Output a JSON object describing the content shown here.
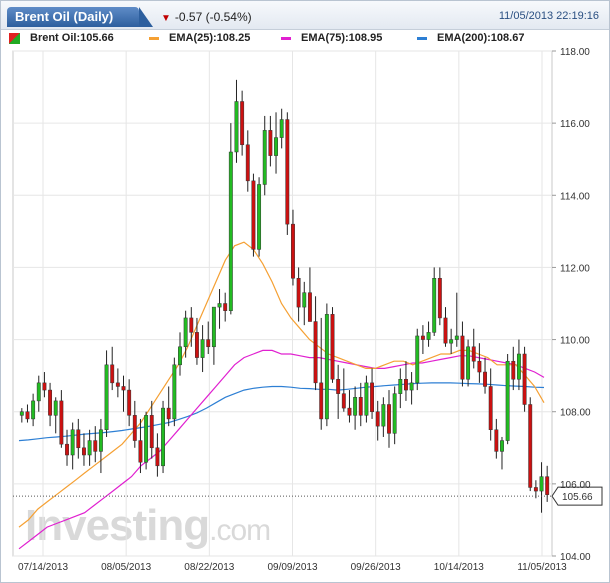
{
  "header": {
    "title": "Brent Oil (Daily)",
    "change": "-0.57 (-0.54%)",
    "datetime": "11/05/2013 22:19:16"
  },
  "legend": {
    "price": "Brent Oil:105.66",
    "ema25": "EMA(25):108.25",
    "ema75": "EMA(75):108.95",
    "ema200": "EMA(200):108.67"
  },
  "watermark": {
    "main": "Investing",
    "suffix": ".com"
  },
  "colors": {
    "up": "#22bb22",
    "down": "#cc1111",
    "ema25": "#f5a033",
    "ema75": "#e020d0",
    "ema200": "#2d7fd4",
    "grid": "#e6e6e6"
  },
  "chart_data": {
    "type": "candlestick",
    "ylim": [
      104,
      118
    ],
    "y_ticks": [
      "104.00",
      "106.00",
      "108.00",
      "110.00",
      "112.00",
      "114.00",
      "116.00",
      "118.00"
    ],
    "x_ticks": [
      "07/14/2013",
      "08/05/2013",
      "08/22/2013",
      "09/09/2013",
      "09/26/2013",
      "10/14/2013",
      "11/05/2013"
    ],
    "last_price": "105.66",
    "ohlc": [
      [
        107.9,
        108.1,
        107.7,
        108.0
      ],
      [
        108.0,
        108.2,
        107.7,
        107.8
      ],
      [
        107.8,
        108.5,
        107.6,
        108.3
      ],
      [
        108.3,
        109.0,
        108.0,
        108.8
      ],
      [
        108.8,
        109.1,
        108.4,
        108.6
      ],
      [
        108.6,
        108.8,
        107.6,
        107.9
      ],
      [
        107.9,
        108.4,
        107.4,
        108.3
      ],
      [
        108.3,
        108.6,
        107.0,
        107.1
      ],
      [
        107.1,
        107.5,
        106.5,
        106.8
      ],
      [
        106.8,
        107.7,
        106.4,
        107.5
      ],
      [
        107.5,
        107.8,
        106.7,
        107.0
      ],
      [
        107.0,
        107.4,
        106.5,
        106.8
      ],
      [
        106.8,
        107.5,
        106.5,
        107.2
      ],
      [
        107.2,
        107.6,
        106.6,
        106.9
      ],
      [
        106.9,
        107.8,
        106.3,
        107.5
      ],
      [
        107.5,
        109.7,
        107.3,
        109.3
      ],
      [
        109.3,
        109.8,
        108.6,
        108.8
      ],
      [
        108.8,
        109.2,
        108.4,
        108.7
      ],
      [
        108.7,
        109.0,
        108.0,
        108.6
      ],
      [
        108.6,
        108.9,
        107.6,
        107.9
      ],
      [
        107.9,
        108.3,
        107.0,
        107.2
      ],
      [
        107.2,
        107.8,
        106.3,
        106.6
      ],
      [
        106.6,
        108.0,
        106.4,
        107.9
      ],
      [
        107.9,
        108.3,
        106.7,
        107.0
      ],
      [
        107.0,
        107.4,
        106.2,
        106.5
      ],
      [
        106.5,
        108.3,
        106.3,
        108.1
      ],
      [
        108.1,
        108.7,
        107.6,
        107.8
      ],
      [
        107.8,
        109.5,
        107.6,
        109.3
      ],
      [
        109.3,
        110.2,
        109.0,
        109.8
      ],
      [
        109.8,
        110.8,
        109.5,
        110.6
      ],
      [
        110.6,
        110.9,
        109.8,
        110.2
      ],
      [
        110.2,
        110.6,
        109.3,
        109.5
      ],
      [
        109.5,
        110.4,
        109.1,
        110.0
      ],
      [
        110.0,
        110.5,
        109.6,
        109.8
      ],
      [
        109.8,
        110.6,
        109.3,
        110.9
      ],
      [
        110.9,
        111.4,
        110.3,
        111.0
      ],
      [
        111.0,
        111.3,
        110.5,
        110.8
      ],
      [
        110.8,
        116.0,
        110.7,
        115.2
      ],
      [
        115.2,
        117.2,
        114.9,
        116.6
      ],
      [
        116.6,
        116.9,
        115.1,
        115.4
      ],
      [
        115.4,
        115.8,
        114.1,
        114.4
      ],
      [
        114.4,
        114.6,
        112.3,
        112.5
      ],
      [
        112.5,
        114.5,
        112.3,
        114.3
      ],
      [
        114.3,
        116.2,
        114.0,
        115.8
      ],
      [
        115.8,
        116.2,
        114.8,
        115.1
      ],
      [
        115.1,
        116.3,
        114.6,
        115.6
      ],
      [
        115.6,
        116.4,
        115.3,
        116.1
      ],
      [
        116.1,
        116.3,
        112.9,
        113.2
      ],
      [
        113.2,
        113.6,
        111.5,
        111.7
      ],
      [
        111.7,
        112.0,
        110.5,
        110.9
      ],
      [
        110.9,
        111.6,
        110.4,
        111.3
      ],
      [
        111.3,
        112.0,
        110.6,
        110.5
      ],
      [
        110.5,
        111.2,
        108.6,
        108.8
      ],
      [
        108.8,
        110.6,
        107.5,
        107.8
      ],
      [
        107.8,
        111.0,
        107.6,
        110.7
      ],
      [
        110.7,
        110.9,
        108.8,
        108.9
      ],
      [
        108.9,
        109.3,
        107.8,
        108.5
      ],
      [
        108.5,
        109.2,
        108.0,
        108.1
      ],
      [
        108.1,
        108.6,
        107.7,
        107.9
      ],
      [
        107.9,
        108.7,
        107.5,
        108.4
      ],
      [
        108.4,
        108.8,
        107.6,
        107.9
      ],
      [
        107.9,
        109.0,
        107.7,
        108.8
      ],
      [
        108.8,
        109.2,
        107.8,
        108.0
      ],
      [
        108.0,
        108.3,
        107.2,
        107.6
      ],
      [
        107.6,
        108.4,
        107.3,
        108.2
      ],
      [
        108.2,
        108.6,
        107.0,
        107.4
      ],
      [
        107.4,
        108.7,
        107.1,
        108.5
      ],
      [
        108.5,
        109.2,
        108.1,
        108.9
      ],
      [
        108.9,
        109.4,
        108.3,
        108.6
      ],
      [
        108.6,
        109.1,
        108.2,
        108.8
      ],
      [
        108.8,
        110.3,
        108.6,
        110.1
      ],
      [
        110.1,
        110.4,
        109.6,
        110.0
      ],
      [
        110.0,
        110.5,
        109.8,
        110.2
      ],
      [
        110.2,
        112.0,
        110.1,
        111.7
      ],
      [
        111.7,
        112.0,
        110.4,
        110.6
      ],
      [
        110.6,
        110.9,
        109.8,
        109.9
      ],
      [
        109.9,
        110.3,
        109.6,
        110.0
      ],
      [
        110.0,
        111.3,
        109.8,
        110.1
      ],
      [
        110.1,
        110.5,
        108.7,
        108.9
      ],
      [
        108.9,
        110.0,
        108.7,
        109.8
      ],
      [
        109.8,
        110.3,
        109.2,
        109.4
      ],
      [
        109.4,
        109.9,
        108.8,
        109.1
      ],
      [
        109.1,
        109.5,
        108.5,
        108.7
      ],
      [
        108.7,
        109.2,
        107.2,
        107.5
      ],
      [
        107.5,
        107.8,
        106.7,
        106.9
      ],
      [
        106.9,
        107.3,
        106.4,
        107.2
      ],
      [
        107.2,
        109.6,
        107.1,
        109.4
      ],
      [
        109.4,
        109.8,
        108.6,
        108.9
      ],
      [
        108.9,
        110.0,
        108.6,
        109.6
      ],
      [
        109.6,
        109.8,
        108.0,
        108.2
      ],
      [
        108.2,
        108.4,
        105.8,
        105.9
      ],
      [
        105.9,
        106.1,
        105.6,
        105.8
      ],
      [
        105.8,
        106.6,
        105.2,
        106.2
      ],
      [
        106.2,
        106.5,
        105.5,
        105.7
      ]
    ],
    "ema25": [
      104.8,
      105.0,
      105.3,
      105.5,
      105.7,
      105.9,
      106.1,
      106.3,
      106.5,
      106.7,
      106.9,
      107.1,
      107.4,
      107.7,
      108.1,
      108.5,
      108.9,
      109.3,
      109.8,
      110.4,
      111.0,
      111.6,
      112.2,
      112.6,
      112.7,
      112.5,
      112.1,
      111.6,
      111.0,
      110.6,
      110.3,
      110.0,
      109.8,
      109.6,
      109.5,
      109.4,
      109.3,
      109.2,
      109.2,
      109.3,
      109.4,
      109.4,
      109.3,
      109.4,
      109.5,
      109.6,
      109.6,
      109.7,
      109.7,
      109.6,
      109.5,
      109.3,
      109.3,
      109.3,
      109.0,
      108.7,
      108.25
    ],
    "ema75": [
      104.2,
      104.4,
      104.6,
      104.8,
      104.9,
      105.0,
      105.1,
      105.2,
      105.4,
      105.6,
      105.8,
      106.0,
      106.2,
      106.5,
      106.7,
      106.9,
      107.2,
      107.5,
      107.8,
      108.1,
      108.4,
      108.7,
      109.0,
      109.3,
      109.5,
      109.6,
      109.7,
      109.7,
      109.6,
      109.6,
      109.55,
      109.5,
      109.5,
      109.45,
      109.4,
      109.35,
      109.3,
      109.25,
      109.2,
      109.2,
      109.25,
      109.3,
      109.35,
      109.35,
      109.4,
      109.45,
      109.5,
      109.55,
      109.55,
      109.5,
      109.45,
      109.4,
      109.35,
      109.3,
      109.2,
      109.1,
      108.95
    ],
    "ema200": [
      107.2,
      107.22,
      107.25,
      107.28,
      107.3,
      107.32,
      107.35,
      107.38,
      107.4,
      107.42,
      107.45,
      107.48,
      107.52,
      107.56,
      107.6,
      107.65,
      107.7,
      107.78,
      107.87,
      107.97,
      108.1,
      108.25,
      108.4,
      108.5,
      108.6,
      108.65,
      108.68,
      108.7,
      108.7,
      108.68,
      108.65,
      108.64,
      108.62,
      108.62,
      108.6,
      108.62,
      108.65,
      108.68,
      108.7,
      108.72,
      108.74,
      108.76,
      108.78,
      108.79,
      108.8,
      108.8,
      108.8,
      108.79,
      108.78,
      108.77,
      108.76,
      108.74,
      108.72,
      108.71,
      108.7,
      108.68,
      108.67
    ]
  }
}
